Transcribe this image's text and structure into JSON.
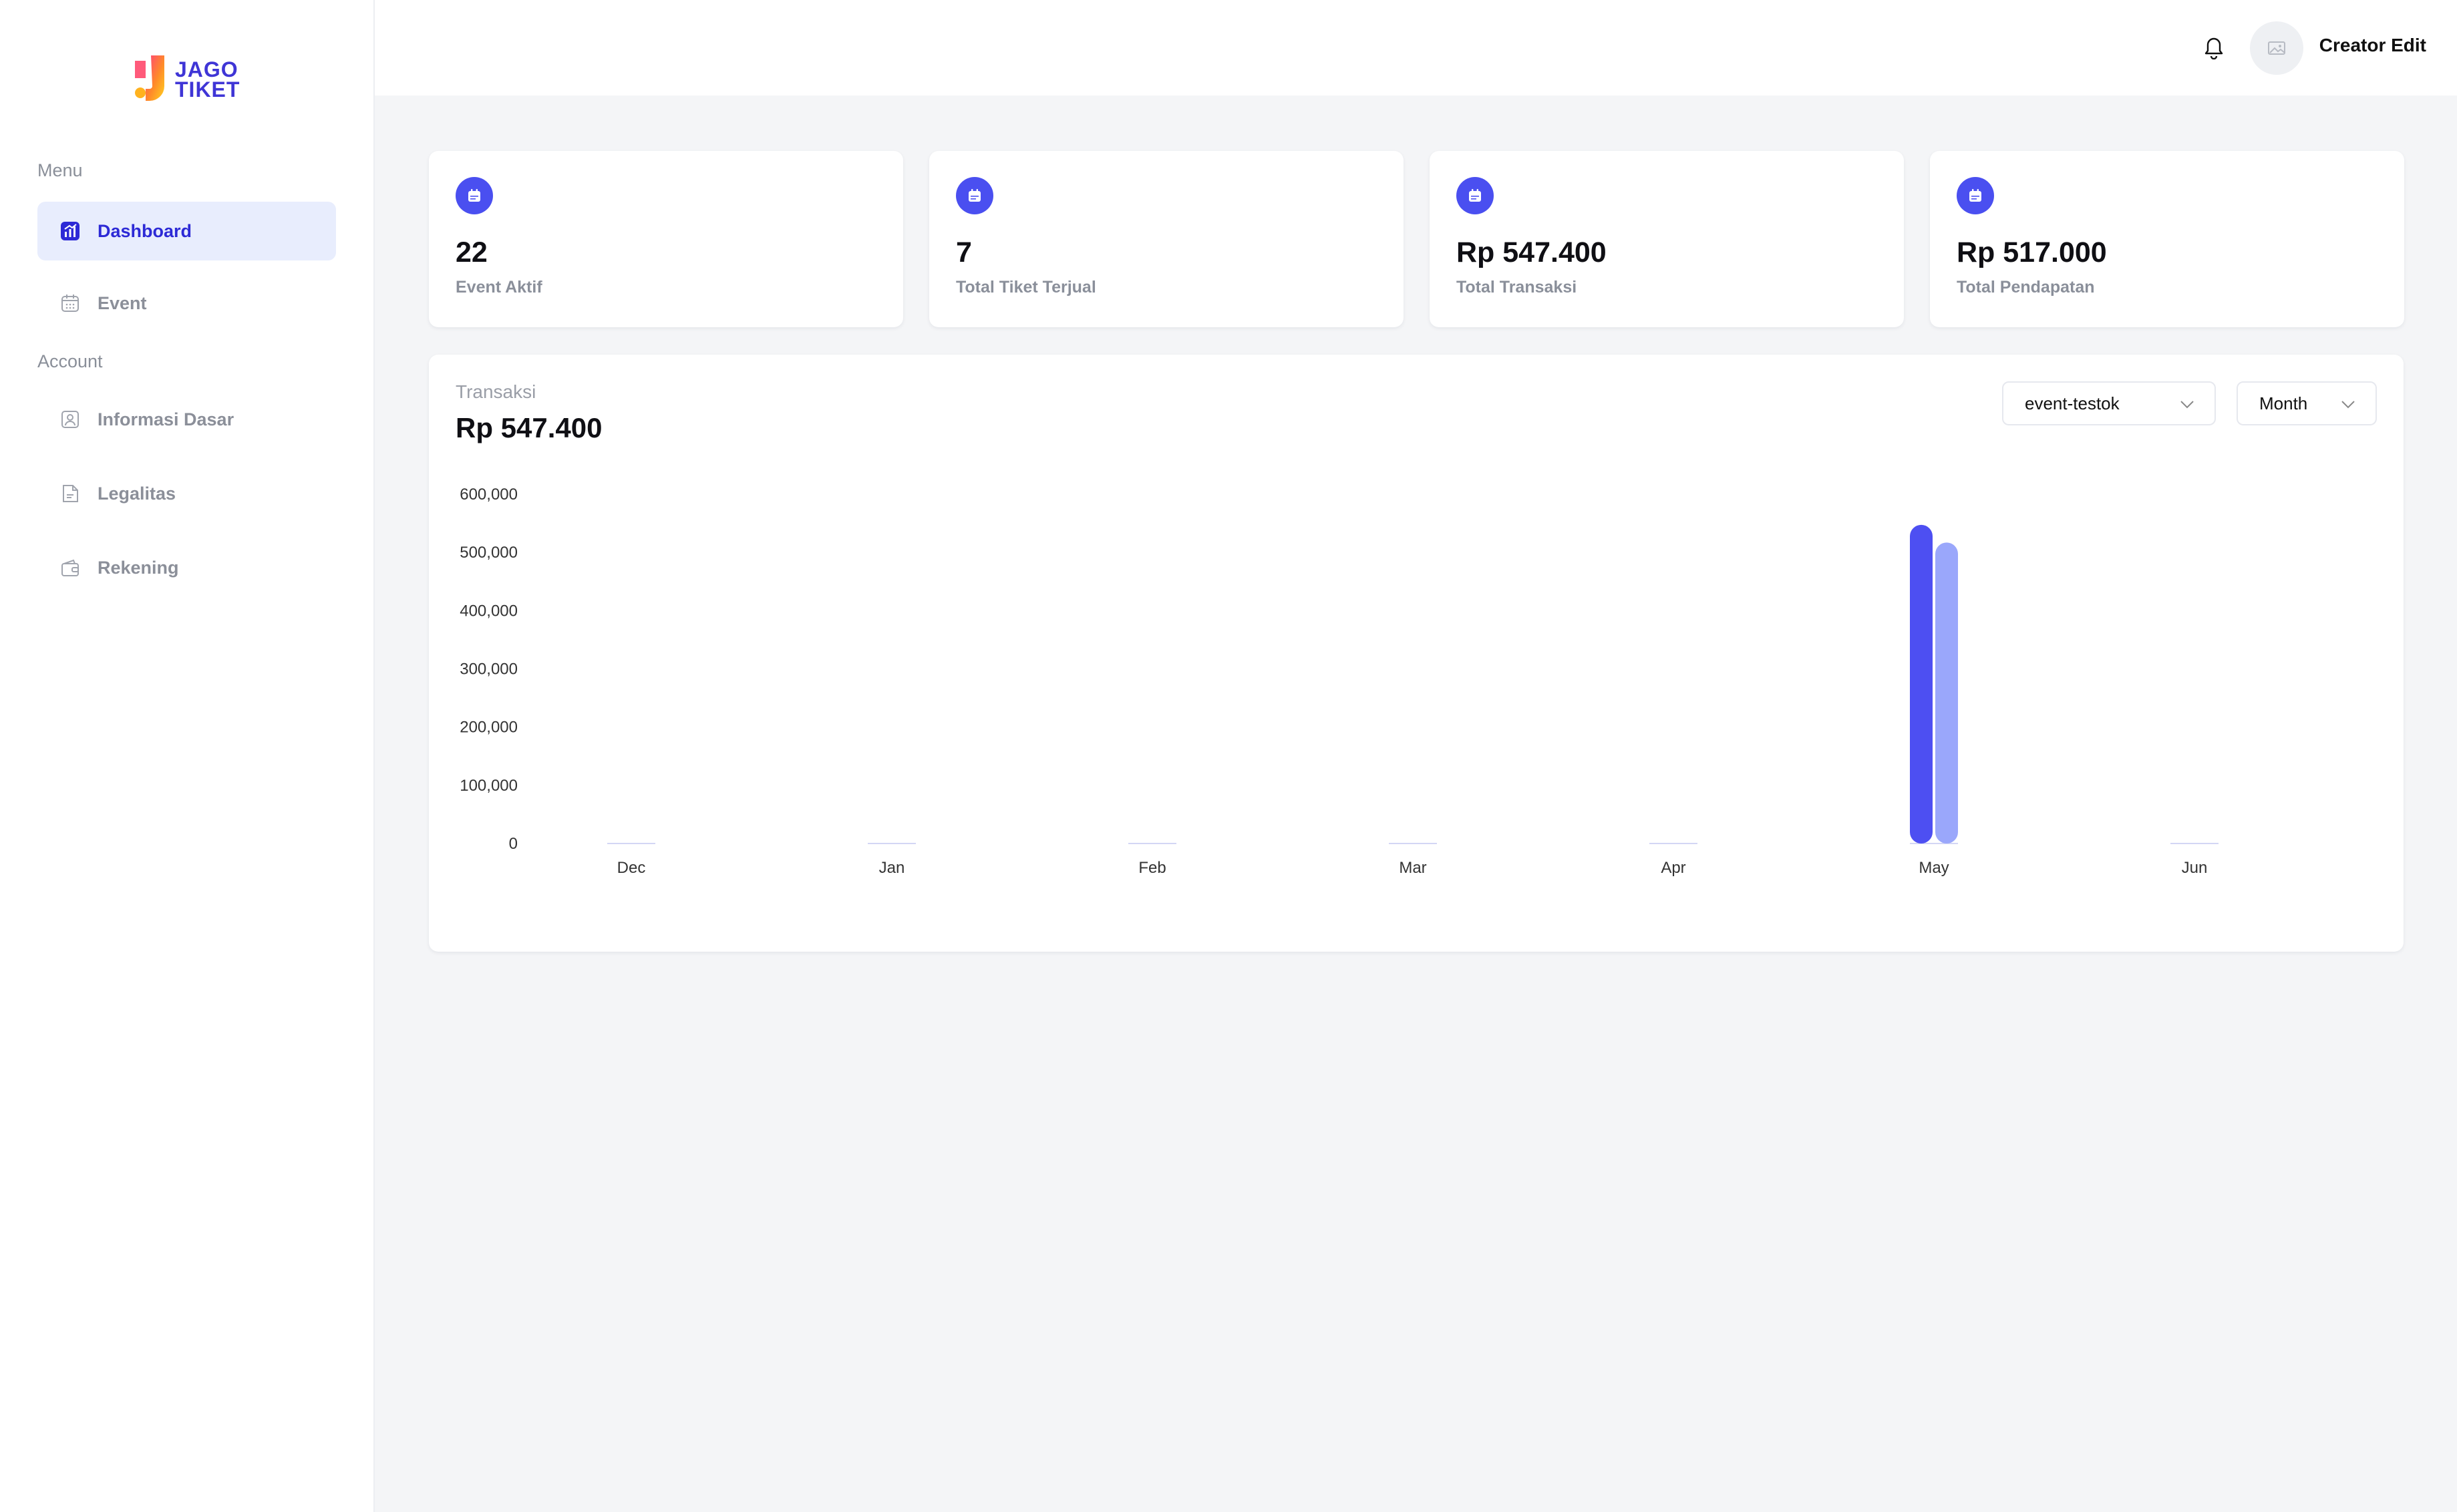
{
  "brand": {
    "line1": "JAGO",
    "line2": "TIKET"
  },
  "sidebar": {
    "menu_label": "Menu",
    "account_label": "Account",
    "menu_items": [
      {
        "label": "Dashboard",
        "icon": "chart-icon",
        "active": true
      },
      {
        "label": "Event",
        "icon": "calendar-icon",
        "active": false
      }
    ],
    "account_items": [
      {
        "label": "Informasi Dasar",
        "icon": "user-card-icon"
      },
      {
        "label": "Legalitas",
        "icon": "document-icon"
      },
      {
        "label": "Rekening",
        "icon": "wallet-icon"
      }
    ]
  },
  "header": {
    "user_name": "Creator Edit",
    "bell_icon": "bell-icon",
    "avatar_icon": "image-placeholder-icon"
  },
  "stats": [
    {
      "value": "22",
      "label": "Event Aktif",
      "icon": "calendar-icon"
    },
    {
      "value": "7",
      "label": "Total Tiket Terjual",
      "icon": "calendar-icon"
    },
    {
      "value": "Rp 547.400",
      "label": "Total Transaksi",
      "icon": "calendar-icon"
    },
    {
      "value": "Rp 517.000",
      "label": "Total Pendapatan",
      "icon": "calendar-icon"
    }
  ],
  "panel": {
    "title": "Transaksi",
    "total": "Rp 547.400",
    "event_select": "event-testok",
    "period_select": "Month"
  },
  "colors": {
    "accent": "#4a4ff0",
    "series_1": "#4d4ff2",
    "series_2": "#9aa7fb",
    "active_nav_bg": "#e8edfd"
  },
  "chart_data": {
    "type": "bar",
    "categories": [
      "Dec",
      "Jan",
      "Feb",
      "Mar",
      "Apr",
      "May",
      "Jun"
    ],
    "series": [
      {
        "values": [
          0,
          0,
          0,
          0,
          0,
          547400,
          0
        ]
      },
      {
        "values": [
          0,
          0,
          0,
          0,
          0,
          517000,
          0
        ]
      }
    ],
    "ylim": [
      0,
      600000
    ],
    "yticks": [
      "0",
      "100,000",
      "200,000",
      "300,000",
      "400,000",
      "500,000",
      "600,000"
    ],
    "title": "",
    "xlabel": "",
    "ylabel": ""
  }
}
